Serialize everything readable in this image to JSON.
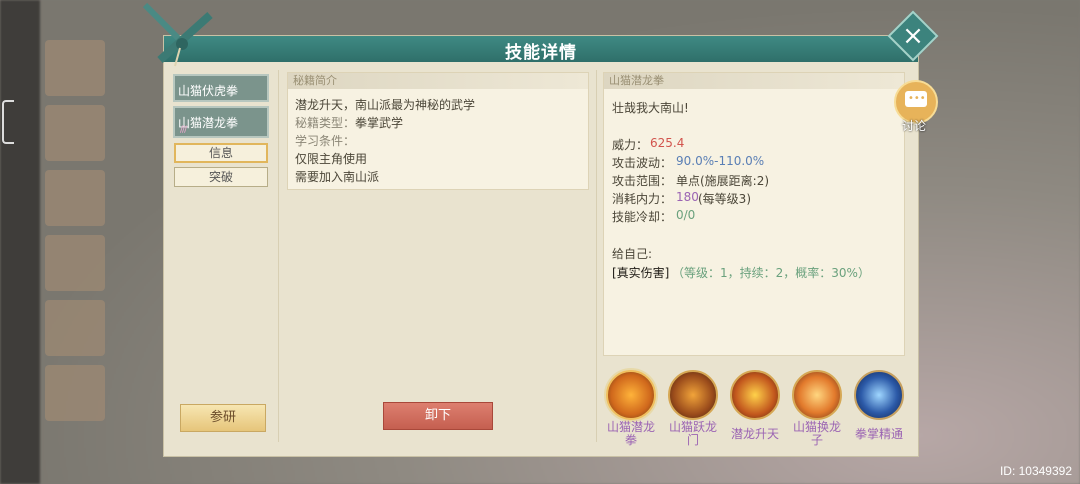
{
  "title": "技能详情",
  "skill_tabs": [
    {
      "label": "山猫伏虎拳"
    },
    {
      "label": "山猫潜龙拳",
      "marks": "///"
    }
  ],
  "sub_buttons": {
    "info": "信息",
    "breakthrough": "突破"
  },
  "left_panel": {
    "header": "秘籍简介",
    "line1": "潜龙升天，南山派最为神秘的武学",
    "type_label": "秘籍类型：",
    "type_value": "拳掌武学",
    "req_label": "学习条件：",
    "req1": "仅限主角使用",
    "req2": "需要加入南山派"
  },
  "right_panel": {
    "header": "山猫潜龙拳",
    "motto": "壮哉我大南山!",
    "power_label": "威力：",
    "power_value": "625.4",
    "wave_label": "攻击波动：",
    "wave_value": "90.0%-110.0%",
    "range_label": "攻击范围：",
    "range_value": "单点(施展距离:2)",
    "cost_label": "消耗内力：",
    "cost_value": "180",
    "cost_suffix": "(每等级3)",
    "cd_label": "技能冷却：",
    "cd_value": "0/0",
    "self_label": "给自己:",
    "effect_name": "[真实伤害]",
    "effect_detail": "（等级：1，持续：2，概率：30%）"
  },
  "buttons": {
    "research": "参研",
    "unload": "卸下"
  },
  "discuss": {
    "label": "讨论"
  },
  "skills": [
    {
      "line1": "山猫潜龙",
      "line2": "拳"
    },
    {
      "line1": "山猫跃龙",
      "line2": "门"
    },
    {
      "line1": "潜龙升天",
      "line2": ""
    },
    {
      "line1": "山猫换龙",
      "line2": "子"
    },
    {
      "line1": "拳掌精通",
      "line2": ""
    }
  ],
  "id_text": "ID: 10349392",
  "colors": {
    "header": "#3a7f79",
    "accent_red": "#d2544d",
    "accent_blue": "#5a7fb5",
    "accent_purple": "#9b64b3",
    "accent_green": "#6aa17d"
  }
}
